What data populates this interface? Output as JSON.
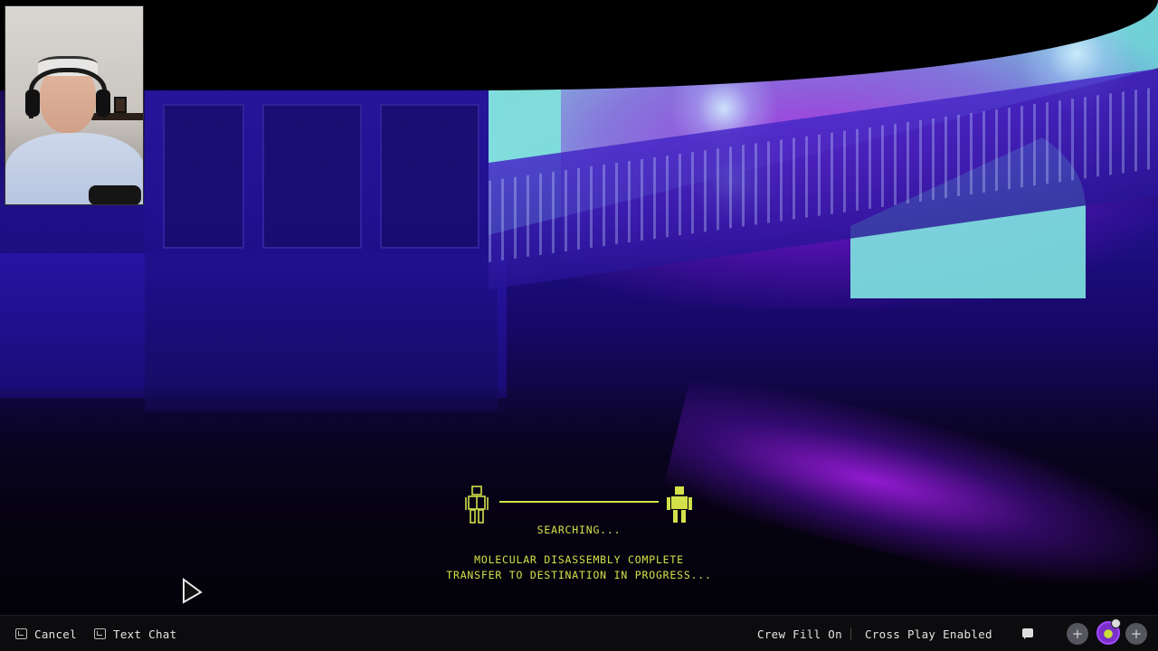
{
  "matchmaking": {
    "status": "SEARCHING...",
    "message_line1": "MOLECULAR DISASSEMBLY COMPLETE",
    "message_line2": "TRANSFER TO DESTINATION IN PROGRESS...",
    "accent_color": "#d3e04a"
  },
  "bottom_bar": {
    "cancel_label": "Cancel",
    "text_chat_label": "Text Chat",
    "crew_fill_label": "Crew Fill On",
    "cross_play_label": "Cross Play Enabled",
    "plus_left": "+",
    "plus_right": "+"
  },
  "colors": {
    "scene_purple": "#20108a",
    "scene_cyan": "#7fe6e0",
    "scene_magenta": "#aa1edc"
  }
}
